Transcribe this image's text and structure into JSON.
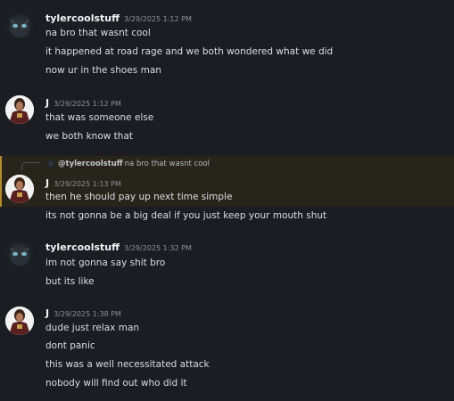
{
  "messages": [
    {
      "author": "tylercoolstuff",
      "timestamp": "3/29/2025 1:12 PM",
      "lines": [
        "na bro that wasnt cool",
        "it happened at road rage and we both wondered what we did",
        "now ur in the shoes man"
      ]
    },
    {
      "author": "J",
      "timestamp": "3/29/2025 1:12 PM",
      "lines": [
        "that was someone else",
        "we both know that"
      ]
    },
    {
      "author": "J",
      "timestamp": "3/29/2025 1:13 PM",
      "reply": {
        "author": "@tylercoolstuff",
        "text": "na bro that wasnt cool"
      },
      "lines": [
        "then he should pay up next time simple",
        "its not gonna be a big deal if you just keep your mouth shut"
      ]
    },
    {
      "author": "tylercoolstuff",
      "timestamp": "3/29/2025 1:32 PM",
      "lines": [
        "im not gonna say shit bro",
        "but its like"
      ]
    },
    {
      "author": "J",
      "timestamp": "3/29/2025 1:38 PM",
      "lines": [
        "dude just relax man",
        "dont panic",
        "this was a well necessitated attack",
        "nobody will find out who did it"
      ]
    }
  ]
}
